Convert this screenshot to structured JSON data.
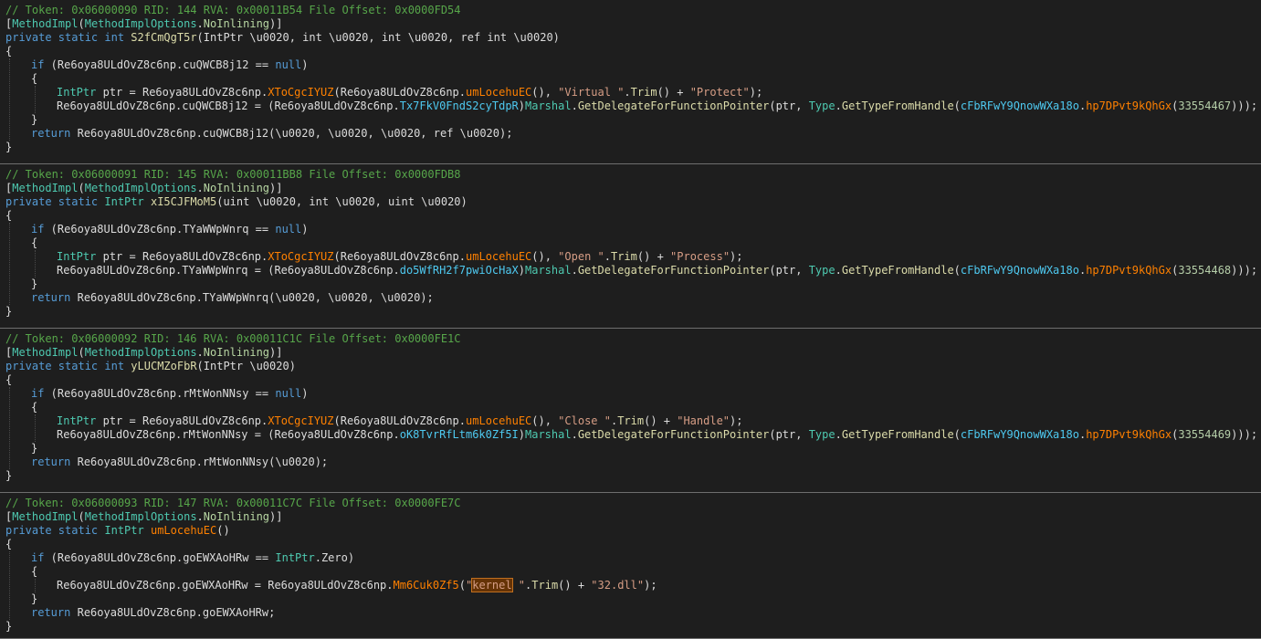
{
  "methods": [
    {
      "comment": "// Token: 0x06000090 RID: 144 RVA: 0x00011B54 File Offset: 0x0000FD54",
      "attr_open": "[",
      "attr_name": "MethodImpl",
      "attr_arg_type": "MethodImplOptions",
      "attr_arg_value": "NoInlining",
      "sig_mods": "private static ",
      "sig_ret": "int",
      "sig_name": "S2fCmQgT5r",
      "sig_params": "(IntPtr \\u0020, int \\u0020, int \\u0020, ref int \\u0020)",
      "if_cond_field": "cuQWCB8j12",
      "if_cond_rhs": "null",
      "ptr_method": "XToCgcIYUZ",
      "ptr_inner_method": "umLocehuEC",
      "ptr_str1": "\"Virtual \"",
      "ptr_str2": "\"Protect\"",
      "assign_field": "cuQWCB8j12",
      "delegate_type": "Tx7FkV0FndS2cyTdpR",
      "handle_class": "cFbRFwY9QnowWXa18o",
      "handle_method": "hp7DPvt9kQhGx",
      "handle_num": "33554467",
      "return_field": "cuQWCB8j12",
      "return_args": "(\\u0020, \\u0020, \\u0020, ref \\u0020);"
    },
    {
      "comment": "// Token: 0x06000091 RID: 145 RVA: 0x00011BB8 File Offset: 0x0000FDB8",
      "attr_open": "[",
      "attr_name": "MethodImpl",
      "attr_arg_type": "MethodImplOptions",
      "attr_arg_value": "NoInlining",
      "sig_mods": "private static ",
      "sig_ret": "IntPtr",
      "sig_name": "xI5CJFMoM5",
      "sig_params": "(uint \\u0020, int \\u0020, uint \\u0020)",
      "if_cond_field": "TYaWWpWnrq",
      "if_cond_rhs": "null",
      "ptr_method": "XToCgcIYUZ",
      "ptr_inner_method": "umLocehuEC",
      "ptr_str1": "\"Open \"",
      "ptr_str2": "\"Process\"",
      "assign_field": "TYaWWpWnrq",
      "delegate_type": "do5WfRH2f7pwiOcHaX",
      "handle_class": "cFbRFwY9QnowWXa18o",
      "handle_method": "hp7DPvt9kQhGx",
      "handle_num": "33554468",
      "return_field": "TYaWWpWnrq",
      "return_args": "(\\u0020, \\u0020, \\u0020);"
    },
    {
      "comment": "// Token: 0x06000092 RID: 146 RVA: 0x00011C1C File Offset: 0x0000FE1C",
      "attr_open": "[",
      "attr_name": "MethodImpl",
      "attr_arg_type": "MethodImplOptions",
      "attr_arg_value": "NoInlining",
      "sig_mods": "private static ",
      "sig_ret": "int",
      "sig_name": "yLUCMZoFbR",
      "sig_params": "(IntPtr \\u0020)",
      "if_cond_field": "rMtWonNNsy",
      "if_cond_rhs": "null",
      "ptr_method": "XToCgcIYUZ",
      "ptr_inner_method": "umLocehuEC",
      "ptr_str1": "\"Close \"",
      "ptr_str2": "\"Handle\"",
      "assign_field": "rMtWonNNsy",
      "delegate_type": "oK8TvrRfLtm6k0Zf5I",
      "handle_class": "cFbRFwY9QnowWXa18o",
      "handle_method": "hp7DPvt9kQhGx",
      "handle_num": "33554469",
      "return_field": "rMtWonNNsy",
      "return_args": "(\\u0020);"
    },
    {
      "comment": "// Token: 0x06000093 RID: 147 RVA: 0x00011C7C File Offset: 0x0000FE7C",
      "attr_open": "[",
      "attr_name": "MethodImpl",
      "attr_arg_type": "MethodImplOptions",
      "attr_arg_value": "NoInlining",
      "sig_mods": "private static ",
      "sig_ret": "IntPtr",
      "sig_name": "umLocehuEC",
      "sig_params": "()",
      "if_cond_field": "goEWXAoHRw",
      "if_cond_rhs_type": "IntPtr",
      "if_cond_rhs_member": "Zero",
      "assign_field": "goEWXAoHRw",
      "load_method": "Mm6Cuk0Zf5",
      "load_str1_hl": "kernel",
      "load_str1_rest": " \"",
      "load_str2": "\"32.dll\"",
      "return_field": "goEWXAoHRw"
    }
  ],
  "common": {
    "class_name": "Re6oya8ULdOvZ8c6np",
    "marshal": "Marshal",
    "gdffp": "GetDelegateForFunctionPointer",
    "type": "Type",
    "gtfh": "GetTypeFromHandle",
    "trim": "Trim",
    "intptr": "IntPtr",
    "ptr": "ptr",
    "kw_if": "if",
    "kw_return": "return"
  }
}
